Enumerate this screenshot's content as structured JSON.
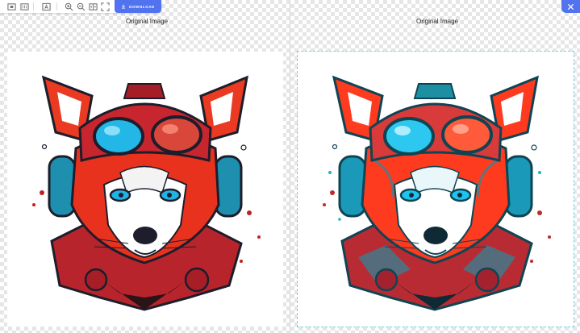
{
  "toolbar": {
    "tools": [
      {
        "icon": "fit-screen-icon"
      },
      {
        "icon": "actual-size-icon"
      },
      {
        "icon": "text-box-icon"
      },
      {
        "icon": "zoom-in-icon"
      },
      {
        "icon": "zoom-out-icon"
      },
      {
        "icon": "compare-view-icon"
      },
      {
        "icon": "fullscreen-icon"
      }
    ],
    "download_label": "DOWNLOAD"
  },
  "panels": {
    "left": {
      "label": "Original Image"
    },
    "right": {
      "label": "Original Image"
    }
  },
  "colors": {
    "accent": "#5273f0",
    "fur_red": "#e8321e",
    "fur_red_right": "#ff3b1f",
    "goggle_cyan": "#22b7e6",
    "dark_outline": "#1d1d2b",
    "selection_outline": "#69d6e3"
  }
}
